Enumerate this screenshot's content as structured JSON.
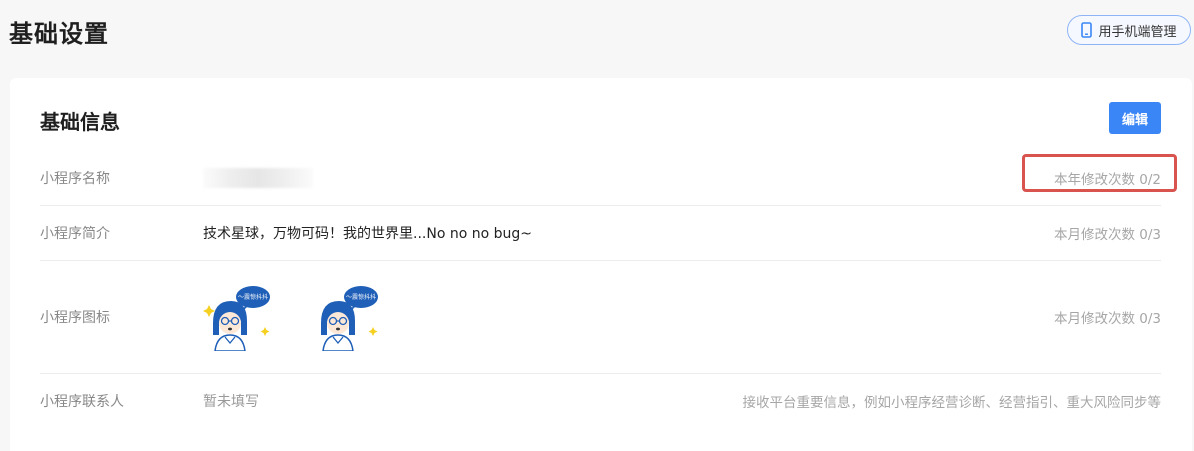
{
  "header": {
    "title": "基础设置",
    "mobile_button_label": "用手机端管理"
  },
  "section": {
    "title": "基础信息",
    "edit_label": "编辑"
  },
  "rows": [
    {
      "label": "小程序名称",
      "value": "",
      "quota": "本年修改次数 0/2"
    },
    {
      "label": "小程序简介",
      "value": "技术星球，万物可码！我的世界里...No no no bug~",
      "quota": "本月修改次数 0/3"
    },
    {
      "label": "小程序图标",
      "value": "",
      "quota": "本月修改次数 0/3"
    },
    {
      "label": "小程序联系人",
      "value": "暂未填写",
      "quota": "接收平台重要信息，例如小程序经营诊断、经营指引、重大风险同步等"
    }
  ],
  "icon_bubble_text": "～震惊抖抖",
  "colors": {
    "accent": "#3a86f6",
    "highlight": "#d9534f",
    "icon_blue": "#1f5fb8"
  }
}
